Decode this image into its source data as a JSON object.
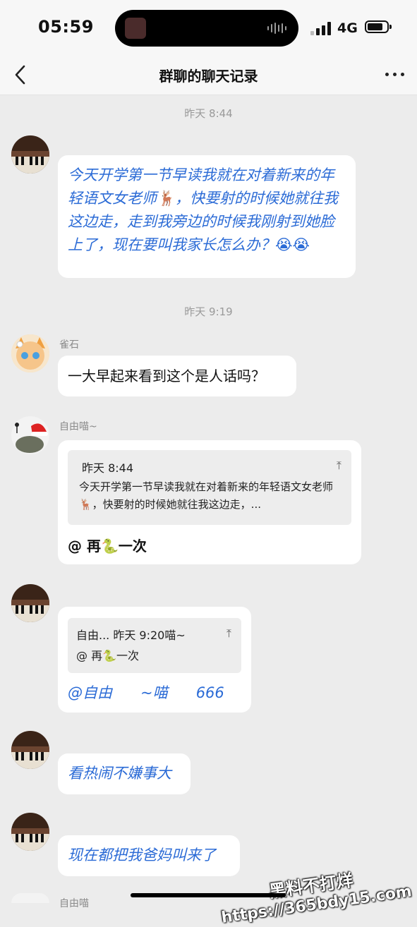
{
  "status": {
    "time": "05:59",
    "network": "4G",
    "battery_level": 0.8
  },
  "nav": {
    "title": "群聊的聊天记录",
    "back_icon": "chevron-left-icon",
    "more_icon": "more-dots-icon"
  },
  "messages": {
    "ts1": "昨天 8:44",
    "m1": "今天开学第一节早读我就在对着新来的年轻语文女老师🦌，快要射的时候她就往我这边走，走到我旁边的时候我刚射到她脸上了，现在要叫我家长怎么办？😭😭",
    "ts2": "昨天 9:19",
    "m2_name": "雀石",
    "m2": "一大早起来看到这个是人话吗？",
    "m3_name": "自由喵~",
    "m3_quote_time": "昨天 8:44",
    "m3_quote_text": "今天开学第一节早读我就在对着新来的年轻语文女老师🦌，快要射的时候她就往我这边走，...",
    "m3": "@ 再🐍一次",
    "m4_quote_header": "自由... 昨天 9:20喵~",
    "m4_quote_text": "@ 再🐍一次",
    "m4": "@自由      ~喵      666",
    "m5": "看热闹不嫌事大",
    "m6": "现在都把我爸妈叫来了",
    "m7_name": "自由喵"
  },
  "watermark": {
    "line1": "黑料不打烊",
    "line2": "https://365bdy15.com"
  }
}
